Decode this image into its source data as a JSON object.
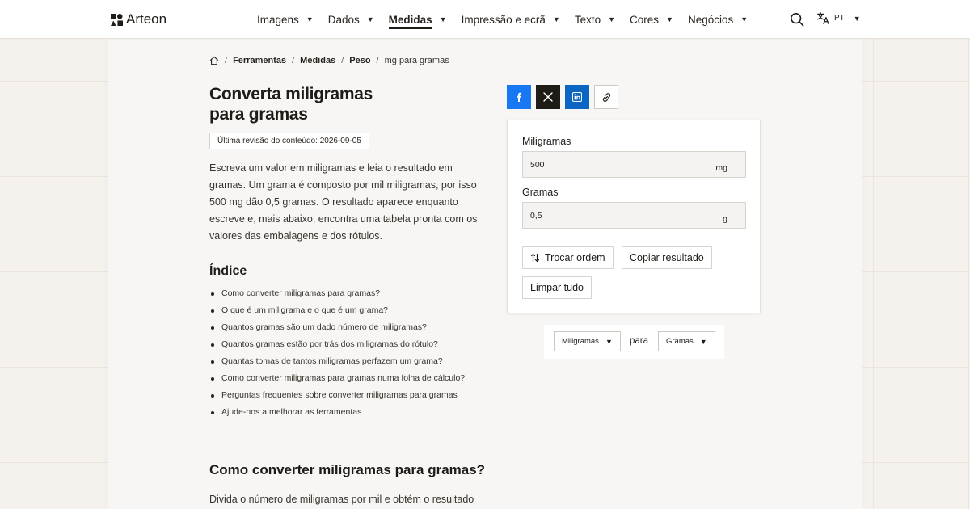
{
  "brand": {
    "name": "Arteon"
  },
  "nav": {
    "items": [
      {
        "label": "Imagens",
        "active": false
      },
      {
        "label": "Dados",
        "active": false
      },
      {
        "label": "Medidas",
        "active": true
      },
      {
        "label": "Impressão e ecrã",
        "active": false
      },
      {
        "label": "Texto",
        "active": false
      },
      {
        "label": "Cores",
        "active": false
      },
      {
        "label": "Negócios",
        "active": false
      }
    ],
    "language": "PT"
  },
  "breadcrumb": {
    "items": [
      "Ferramentas",
      "Medidas",
      "Peso"
    ],
    "current": "mg para gramas"
  },
  "page": {
    "title": "Converta miligramas para gramas",
    "review": "Última revisão do conteúdo: 2026-09-05",
    "intro": "Escreva um valor em miligramas e leia o resultado em gramas. Um grama é composto por mil miligramas, por isso 500 mg dão 0,5 gramas. O resultado aparece enquanto escreve e, mais abaixo, encontra uma tabela pronta com os valores das embalagens e dos rótulos."
  },
  "toc": {
    "title": "Índice",
    "items": [
      "Como converter miligramas para gramas?",
      "O que é um miligrama e o que é um grama?",
      "Quantos gramas são um dado número de miligramas?",
      "Quantos gramas estão por trás dos miligramas do rótulo?",
      "Quantas tomas de tantos miligramas perfazem um grama?",
      "Como converter miligramas para gramas numa folha de cálculo?",
      "Perguntas frequentes sobre converter miligramas para gramas",
      "Ajude-nos a melhorar as ferramentas"
    ]
  },
  "section": {
    "title": "Como converter miligramas para gramas?",
    "text": "Divida o número de miligramas por mil e obtém o resultado"
  },
  "converter": {
    "from_label": "Miligramas",
    "from_value": "500",
    "from_unit": "mg",
    "to_label": "Gramas",
    "to_value": "0,5",
    "to_unit": "g",
    "swap_label": "Trocar ordem",
    "copy_label": "Copiar resultado",
    "clear_label": "Limpar tudo"
  },
  "unit_selector": {
    "from": "Miligramas",
    "between": "para",
    "to": "Gramas"
  },
  "colors": {
    "facebook": "#1877f2",
    "x": "#1f1b17",
    "linkedin": "#0a66c2"
  }
}
